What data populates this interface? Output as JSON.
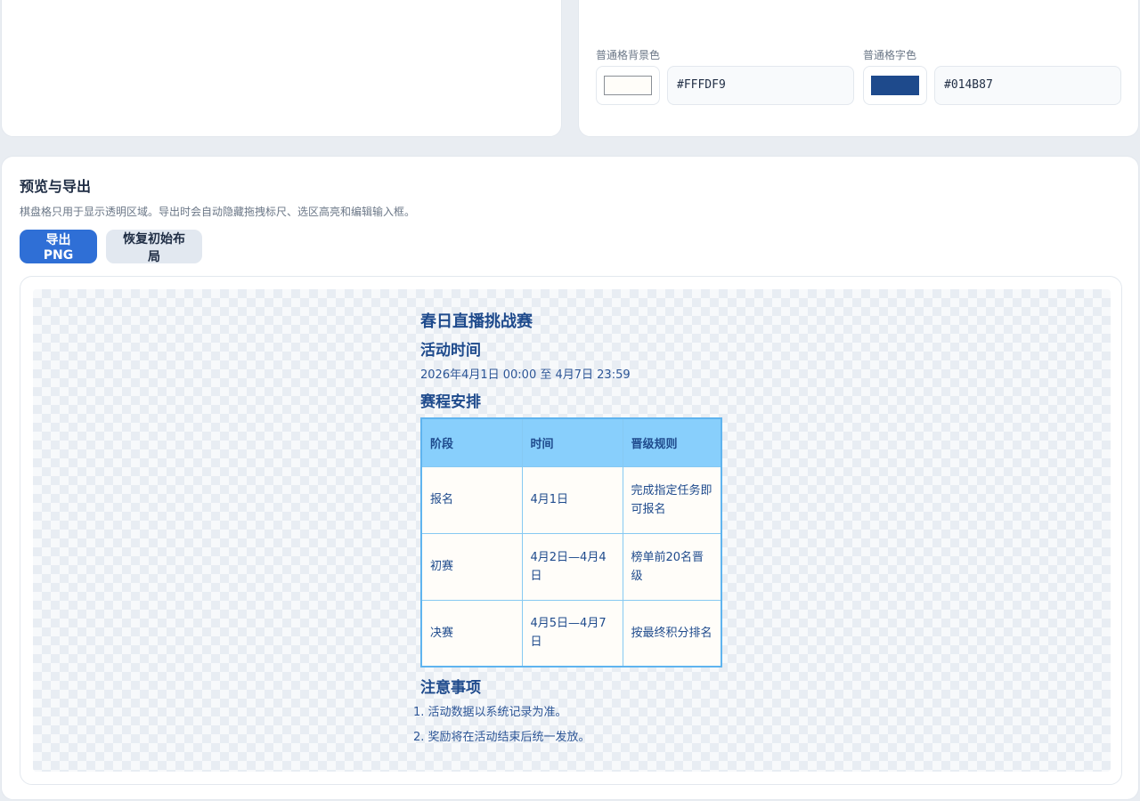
{
  "colors": {
    "header_bg_swatch": "#CEEFFF",
    "header_text_swatch": "#014B87",
    "cell_bg_swatch": "#FFFDF9",
    "cell_text_swatch": "#014B87",
    "accent": "#2f6fd6"
  },
  "style_panel": {
    "header_bg_hex": "#CEEFFF",
    "header_text_hex": "#014B87",
    "cell_bg_label": "普通格背景色",
    "cell_bg_hex": "#FFFDF9",
    "cell_text_label": "普通格字色",
    "cell_text_hex": "#014B87"
  },
  "preview": {
    "title": "预览与导出",
    "description": "棋盘格只用于显示透明区域。导出时会自动隐藏拖拽标尺、选区高亮和编辑输入框。",
    "export_label": "导出 PNG",
    "reset_label": "恢复初始布局"
  },
  "doc": {
    "title": "春日直播挑战赛",
    "time_heading": "活动时间",
    "time_text": "2026年4月1日 00:00 至 4月7日 23:59",
    "schedule_heading": "赛程安排",
    "table": {
      "headers": [
        "阶段",
        "时间",
        "晋级规则"
      ],
      "rows": [
        [
          "报名",
          "4月1日",
          "完成指定任务即可报名"
        ],
        [
          "初赛",
          "4月2日—4月4日",
          "榜单前20名晋级"
        ],
        [
          "决赛",
          "4月5日—4月7日",
          "按最终积分排名"
        ]
      ]
    },
    "notes_heading": "注意事项",
    "notes": [
      "1. 活动数据以系统记录为准。",
      "2. 奖励将在活动结束后统一发放。"
    ]
  }
}
